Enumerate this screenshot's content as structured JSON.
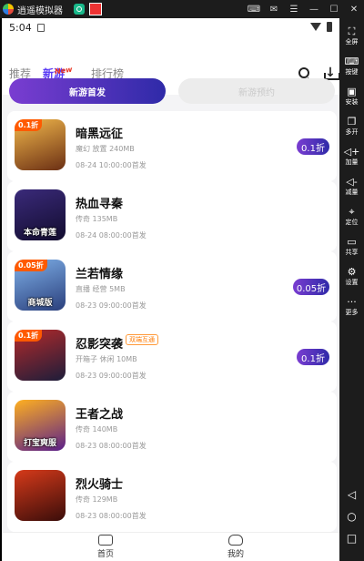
{
  "titlebar": {
    "title": "逍遥模拟器",
    "controls": [
      "keyboard-icon",
      "mail-icon",
      "menu-icon",
      "minimize-icon",
      "maximize-icon",
      "close-icon"
    ]
  },
  "statusbar": {
    "time": "5:04"
  },
  "header": {
    "tabs": [
      {
        "label": "推荐",
        "active": false
      },
      {
        "label": "新游",
        "active": true
      },
      {
        "label": "排行榜",
        "active": false
      }
    ],
    "new_badge": "New"
  },
  "segment": {
    "active": "新游首发",
    "inactive": "新游预约"
  },
  "games": [
    {
      "name": "暗黑远征",
      "meta": "魔幻 放置 240MB",
      "date": "08-24 10:00:00首发",
      "discount": "0.1折",
      "thumb_tag": "0.1折",
      "thumb_caption": "",
      "tag": "",
      "colors": [
        "#f2b84b",
        "#6b2f14"
      ]
    },
    {
      "name": "热血寻秦",
      "meta": "传奇 135MB",
      "date": "08-24 08:00:00首发",
      "discount": "",
      "thumb_tag": "",
      "thumb_caption": "本命青莲",
      "tag": "",
      "colors": [
        "#3a2a7a",
        "#120c2e"
      ]
    },
    {
      "name": "兰若情缘",
      "meta": "直播 经营 5MB",
      "date": "08-23 09:00:00首发",
      "discount": "0.05折",
      "thumb_tag": "0.05折",
      "thumb_caption": "商城版",
      "tag": "",
      "colors": [
        "#7fb0e8",
        "#2a3f7c"
      ]
    },
    {
      "name": "忍影突袭",
      "meta": "开箱子 休闲 10MB",
      "date": "08-23 09:00:00首发",
      "discount": "0.1折",
      "thumb_tag": "0.1折",
      "thumb_caption": "",
      "tag": "双端互通",
      "colors": [
        "#b52a2a",
        "#1d1d3a"
      ]
    },
    {
      "name": "王者之战",
      "meta": "传奇 140MB",
      "date": "08-23 08:00:00首发",
      "discount": "",
      "thumb_tag": "",
      "thumb_caption": "打宝爽服",
      "tag": "",
      "colors": [
        "#ffb020",
        "#5a1f8a"
      ]
    },
    {
      "name": "烈火骑士",
      "meta": "传奇 129MB",
      "date": "08-23 08:00:00首发",
      "discount": "",
      "thumb_tag": "",
      "thumb_caption": "",
      "tag": "",
      "colors": [
        "#d63a1a",
        "#3a0d0a"
      ]
    }
  ],
  "bottomnav": {
    "home": "首页",
    "mine": "我的"
  },
  "sidebar": [
    {
      "label": "全屏",
      "icon": "fullscreen-icon",
      "glyph": "⛶"
    },
    {
      "label": "按键",
      "icon": "keyboard-icon",
      "glyph": "⌨"
    },
    {
      "label": "安装",
      "icon": "apk-install-icon",
      "glyph": "▣"
    },
    {
      "label": "多开",
      "icon": "multi-instance-icon",
      "glyph": "❐"
    },
    {
      "label": "加量",
      "icon": "volume-up-icon",
      "glyph": "◁+"
    },
    {
      "label": "减量",
      "icon": "volume-down-icon",
      "glyph": "◁-"
    },
    {
      "label": "定位",
      "icon": "location-icon",
      "glyph": "⌖"
    },
    {
      "label": "共享",
      "icon": "folder-icon",
      "glyph": "▭"
    },
    {
      "label": "设置",
      "icon": "gear-icon",
      "glyph": "⚙"
    },
    {
      "label": "更多",
      "icon": "more-icon",
      "glyph": "···"
    }
  ],
  "accent": "#5b3df5"
}
